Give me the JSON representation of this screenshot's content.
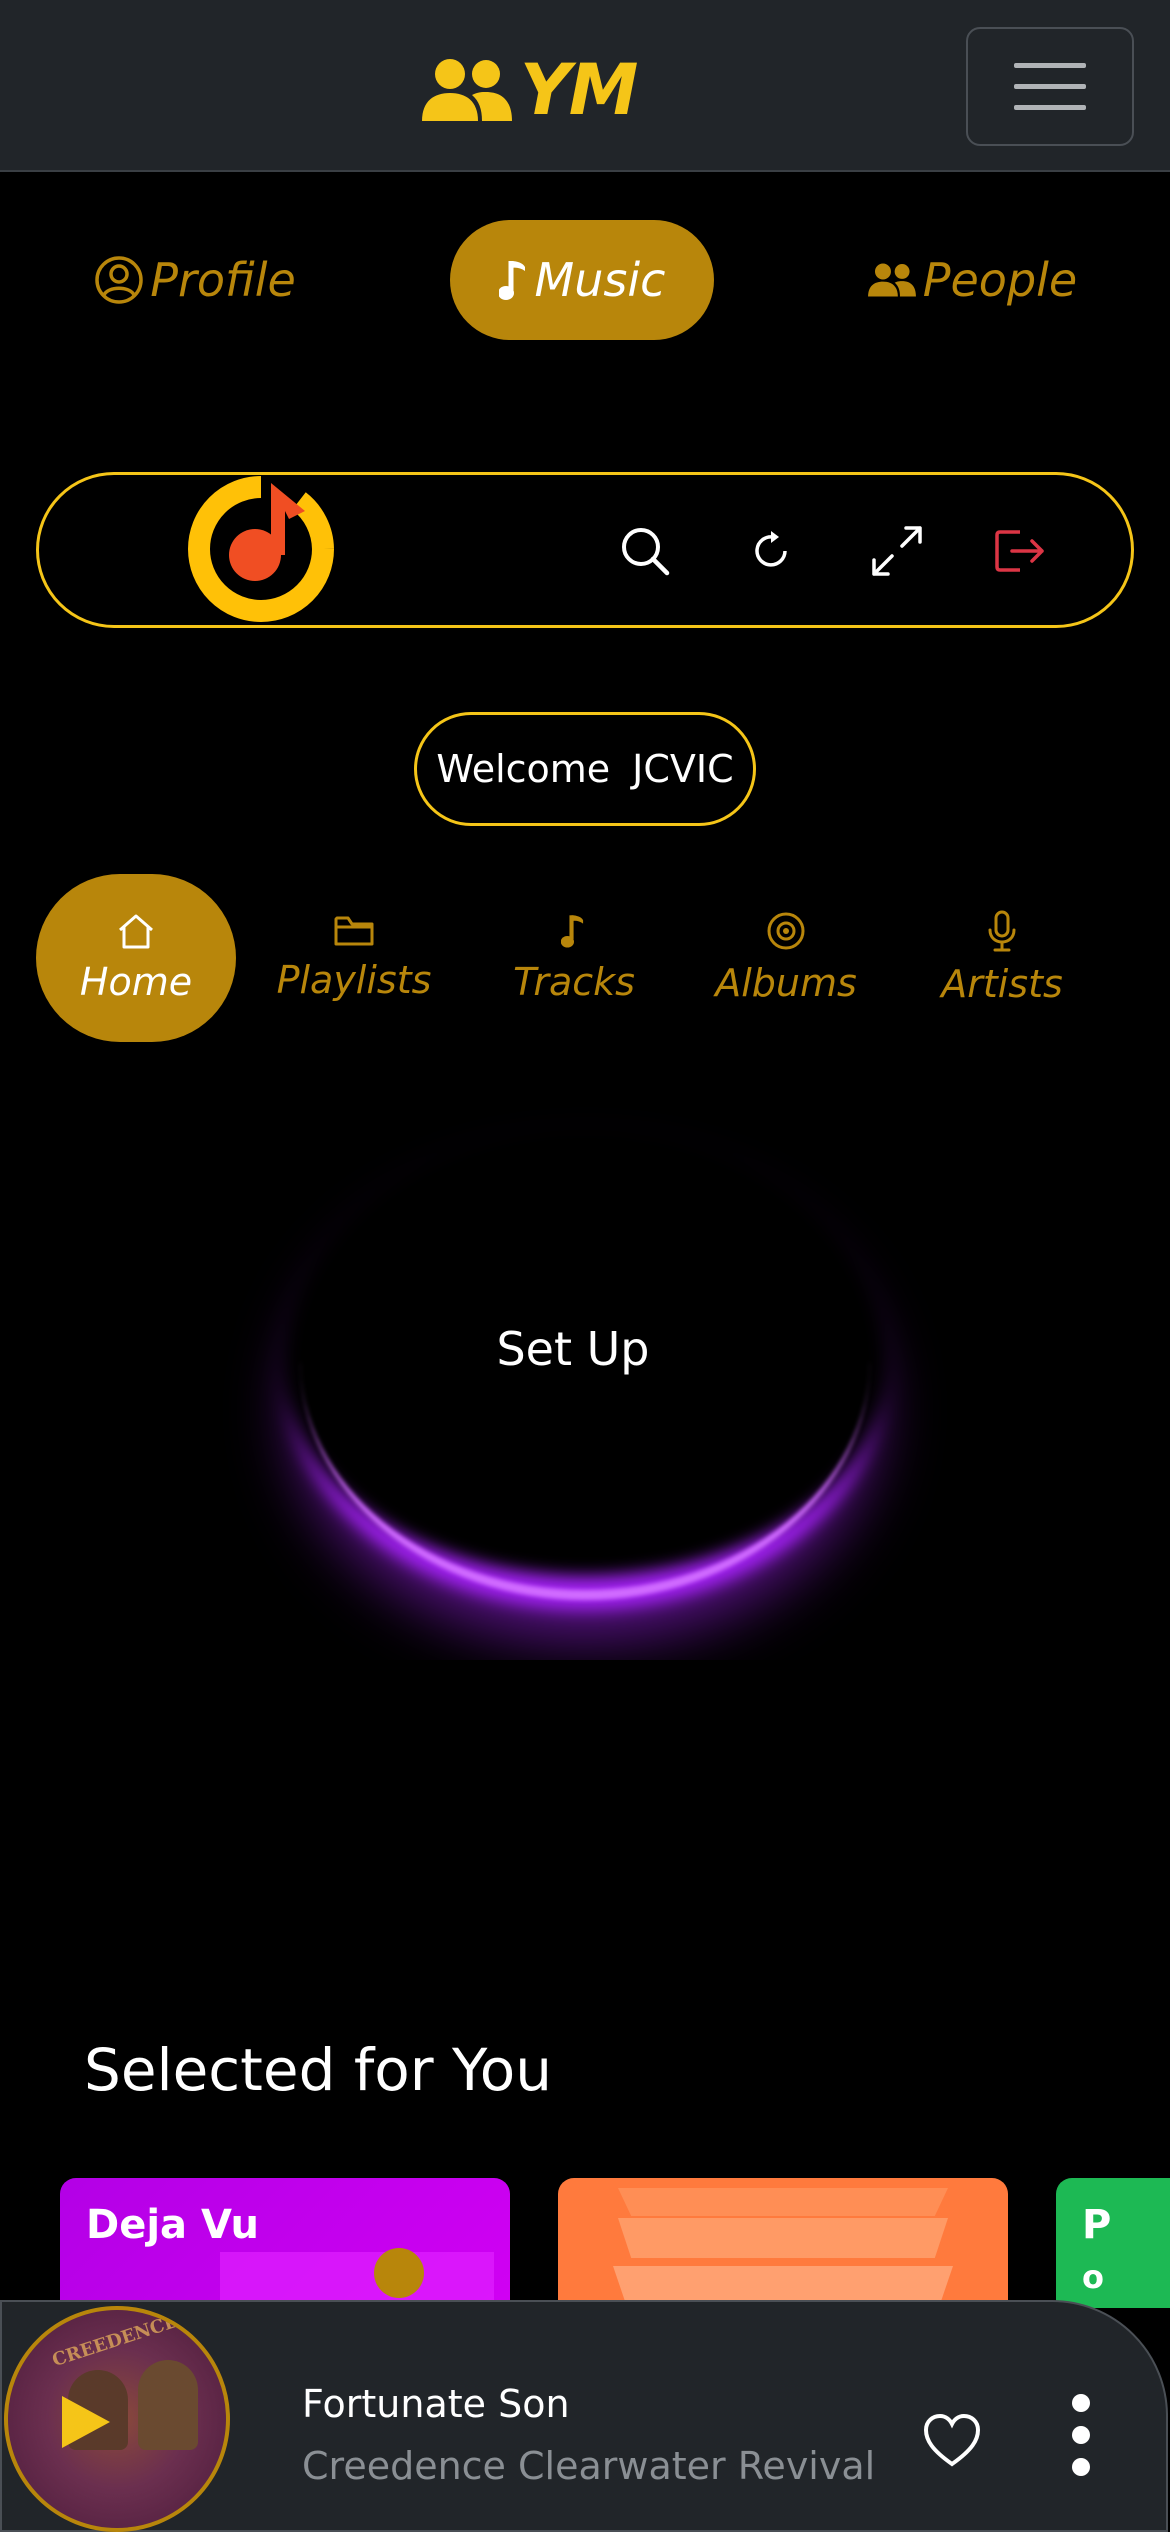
{
  "navbar": {
    "brand": "YM",
    "menu_label": ""
  },
  "main_tabs": [
    {
      "label": "Profile",
      "icon": "user-circle-icon",
      "active": false
    },
    {
      "label": "Music",
      "icon": "music-note-icon",
      "active": true
    },
    {
      "label": "People",
      "icon": "people-icon",
      "active": false
    }
  ],
  "toolbar": {
    "logo": "music-app-logo",
    "buttons": [
      "search-icon",
      "refresh-icon",
      "fullscreen-icon",
      "logout-icon"
    ]
  },
  "welcome": {
    "greeting": "Welcome",
    "username": "JCVIC"
  },
  "sub_tabs": [
    {
      "label": "Home",
      "icon": "home-icon",
      "active": true
    },
    {
      "label": "Playlists",
      "icon": "folder-icon",
      "active": false
    },
    {
      "label": "Tracks",
      "icon": "music-note-icon",
      "active": false
    },
    {
      "label": "Albums",
      "icon": "disc-icon",
      "active": false
    },
    {
      "label": "Artists",
      "icon": "microphone-icon",
      "active": false
    }
  ],
  "setup": {
    "label": "Set Up"
  },
  "selected": {
    "title": "Selected for You",
    "cards": [
      {
        "title": "Deja Vu",
        "color": "#c000f0"
      },
      {
        "title": "",
        "color": "#ff7a3d"
      },
      {
        "title": "P",
        "subtitle": "o",
        "color": "#1db954"
      }
    ]
  },
  "player": {
    "title": "Fortunate Son",
    "artist": "Creedence Clearwater Revival"
  },
  "colors": {
    "accent": "#b8860b",
    "brand_yellow": "#f5c518",
    "logout_red": "#dc3545",
    "glow_purple": "#a020f0"
  }
}
